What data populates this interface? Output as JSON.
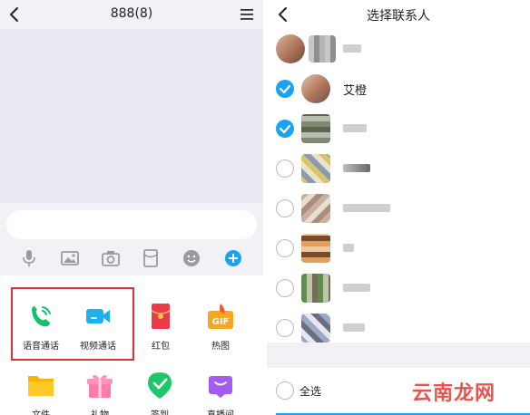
{
  "left": {
    "title": "888(8)",
    "input_placeholder": "",
    "toolbar": [
      "microphone-icon",
      "image-icon",
      "camera-icon",
      "red-packet-icon",
      "emoji-icon",
      "plus-icon"
    ],
    "grid": [
      {
        "label": "语音通话",
        "icon": "phone-call-icon",
        "color": "#12c26b"
      },
      {
        "label": "视频通话",
        "icon": "video-call-icon",
        "color": "#1ab3f2"
      },
      {
        "label": "红包",
        "icon": "red-envelope-icon",
        "color": "#e93c48"
      },
      {
        "label": "热图",
        "icon": "hot-gif-icon",
        "color": "#f5a623"
      },
      {
        "label": "文件",
        "icon": "folder-icon",
        "color": "#f7b500"
      },
      {
        "label": "礼物",
        "icon": "gift-icon",
        "color": "#ff7da6"
      },
      {
        "label": "签到",
        "icon": "check-in-icon",
        "color": "#1fc66a"
      },
      {
        "label": "直播间",
        "icon": "live-room-icon",
        "color": "#a25cf0"
      }
    ]
  },
  "right": {
    "title": "选择联系人",
    "contacts": [
      {
        "name": "",
        "checked": false,
        "show_check": false
      },
      {
        "name": "艾橙",
        "checked": true,
        "show_check": true
      },
      {
        "name": "",
        "checked": true,
        "show_check": true
      },
      {
        "name": "",
        "checked": false,
        "show_check": true
      },
      {
        "name": "",
        "checked": false,
        "show_check": true
      },
      {
        "name": "",
        "checked": false,
        "show_check": true
      },
      {
        "name": "",
        "checked": false,
        "show_check": true
      },
      {
        "name": "",
        "checked": false,
        "show_check": true
      }
    ],
    "select_all": "全选",
    "watermark": "云南龙网"
  },
  "colors": {
    "accent": "#1aa3f2",
    "highlight": "#e0303a"
  }
}
